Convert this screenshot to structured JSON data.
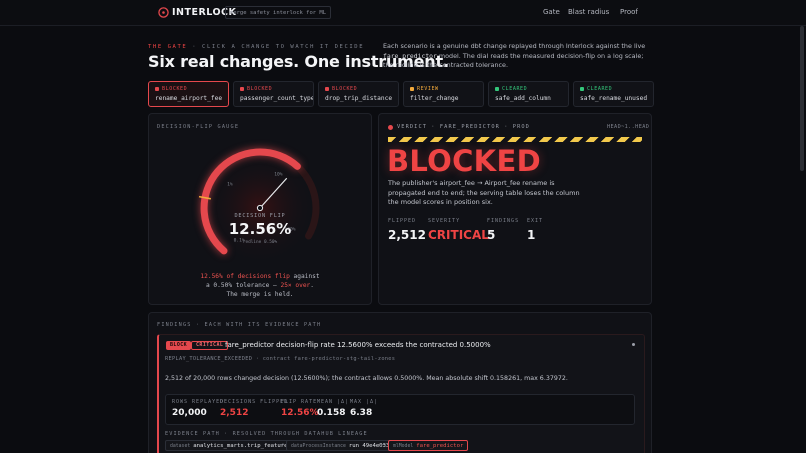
{
  "nav": {
    "brand": "INTERLOCK",
    "tagline": "merge safety interlock for ML",
    "links": [
      "Gate",
      "Blast radius",
      "Proof"
    ]
  },
  "hero": {
    "eyebrow_prefix": "THE GATE",
    "eyebrow_rest": " · CLICK A CHANGE TO WATCH IT DECIDE",
    "title": "Six real changes. One instrument.",
    "desc_1": "Each scenario is a genuine dbt change replayed through Interlock against the live ",
    "desc_code": "fare_predictor",
    "desc_2": " model. The dial reads the measured decision-flip on a log scale; the redline is the contracted tolerance."
  },
  "scenarios": [
    {
      "status": "BLOCKED",
      "name": "rename_airport_fee",
      "color": "#e5484d",
      "active": true
    },
    {
      "status": "BLOCKED",
      "name": "passenger_count_type",
      "color": "#e5484d",
      "active": false
    },
    {
      "status": "BLOCKED",
      "name": "drop_trip_distance",
      "color": "#e5484d",
      "active": false
    },
    {
      "status": "REVIEW",
      "name": "filter_change",
      "color": "#f2a93b",
      "active": false
    },
    {
      "status": "CLEARED",
      "name": "safe_add_column",
      "color": "#34c77b",
      "active": false
    },
    {
      "status": "CLEARED",
      "name": "safe_rename_unused",
      "color": "#34c77b",
      "active": false
    }
  ],
  "gauge": {
    "label": "DECISION-FLIP GAUGE",
    "ticks": [
      "0.1%",
      "1%",
      "10%",
      "100%"
    ],
    "center_label": "DECISION FLIP",
    "value": "12.56%",
    "redline": "redline 0.50%",
    "caption_red": "12.56% of decisions flip",
    "caption_1": " against a 0.50% tolerance — ",
    "caption_red2": "25× over",
    "caption_2": ". The merge is held."
  },
  "verdict": {
    "head": "VERDICT · FARE_PREDICTOR · PROD",
    "ref": "HEAD~1..HEAD",
    "word": "BLOCKED",
    "desc": "The publisher's airport_fee → Airport_fee rename is propagated end to end; the serving table loses the column the model scores in position six.",
    "metrics": [
      {
        "label": "FLIPPED",
        "value": "2,512",
        "red": false
      },
      {
        "label": "SEVERITY",
        "value": "CRITICAL",
        "red": true
      },
      {
        "label": "FINDINGS",
        "value": "5",
        "red": false
      },
      {
        "label": "EXIT",
        "value": "1",
        "red": false
      }
    ]
  },
  "findings": {
    "label": "FINDINGS · EACH WITH ITS EVIDENCE PATH",
    "badge_block": "BLOCK",
    "badge_severity": "CRITICAL",
    "title": "fare_predictor decision-flip rate 12.5600% exceeds the contracted 0.5000%",
    "code": "REPLAY_TOLERANCE_EXCEEDED · contract fare-predictor-stg-tail-zones",
    "body": "2,512 of 20,000 rows changed decision (12.5600%); the contract allows 0.5000%. Mean absolute shift 0.158261, max 6.37972.",
    "stats": [
      {
        "label": "ROWS REPLAYED",
        "value": "20,000",
        "red": false
      },
      {
        "label": "DECISIONS FLIPPED",
        "value": "2,512",
        "red": true
      },
      {
        "label": "FLIP RATE",
        "value": "12.56%",
        "red": true
      },
      {
        "label": "MEAN |Δ|",
        "value": "0.158",
        "red": false
      },
      {
        "label": "MAX |Δ|",
        "value": "6.38",
        "red": false
      }
    ],
    "evidence_label": "EVIDENCE PATH · RESOLVED THROUGH DATAHUB LINEAGE",
    "evidence": [
      {
        "kind": "dataset",
        "value": "analytics_marts.trip_features",
        "red": false
      },
      {
        "kind": "dataProcessInstance",
        "value": "run 49e4e033",
        "red": false
      },
      {
        "kind": "mlModel",
        "value": "fare_predictor",
        "red": true
      }
    ]
  },
  "colors": {
    "accent_red": "#e5484d",
    "review_amber": "#f2a93b",
    "cleared_green": "#34c77b",
    "hazard_yellow": "#f2c94c"
  }
}
